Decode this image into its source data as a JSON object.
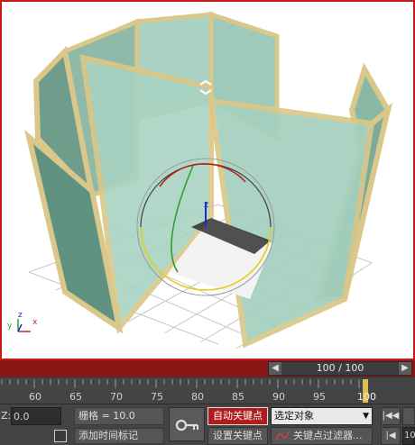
{
  "viewport": {
    "axis_labels": {
      "x": "x",
      "y": "y",
      "z": "z"
    },
    "gizmo_label": "z"
  },
  "time_slider": {
    "position_text": "100 / 100",
    "prev_icon": "chevron-left-icon",
    "next_icon": "chevron-right-icon",
    "current_frame": 100,
    "total_frames": 100
  },
  "ruler": {
    "ticks": [
      "60",
      "65",
      "70",
      "75",
      "80",
      "85",
      "90",
      "95",
      "100"
    ]
  },
  "status": {
    "z_label": "Z:",
    "z_value": "0.0",
    "grid_text": "栅格 = 10.0",
    "add_time_tag": "添加时间标记",
    "auto_key": "自动关键点",
    "set_key": "设置关键点",
    "selection_mode": "选定对象",
    "key_filters": "关键点过滤器...",
    "key_icon": "key-icon",
    "goto_start_icon": "goto-start-icon",
    "prev_frame_icon": "prev-frame-icon",
    "frame_field_partial": "10"
  },
  "colors": {
    "auto_key_active": "#b01c1c",
    "viewport_border": "#c61a1a",
    "timebar": "#8a1313"
  }
}
